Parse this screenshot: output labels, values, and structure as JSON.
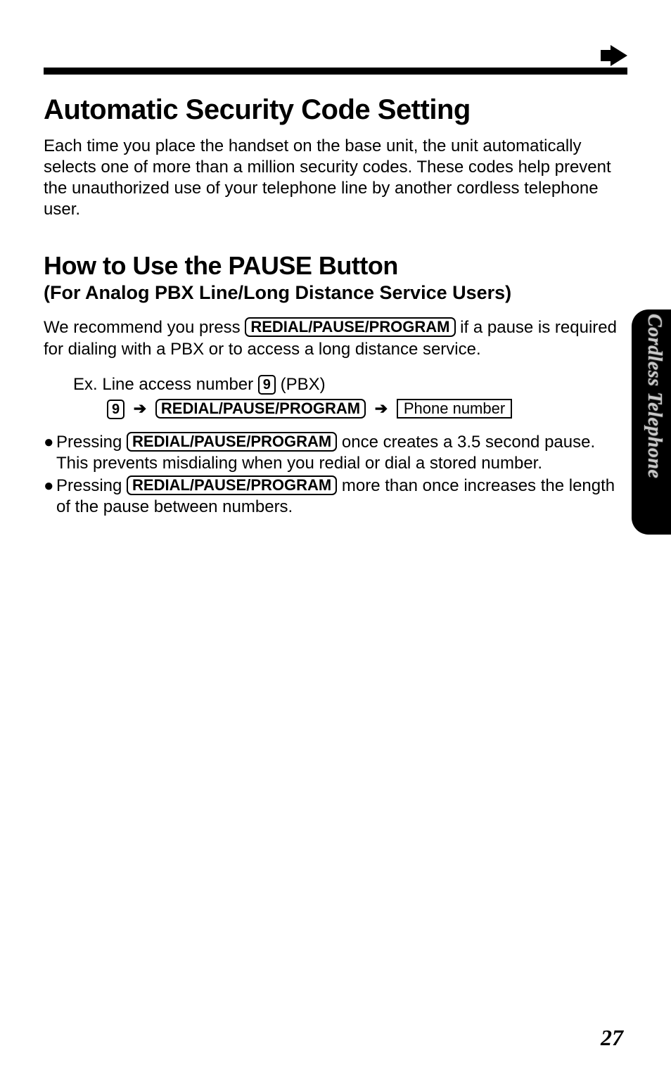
{
  "page_number": "27",
  "side_tab": "Cordless Telephone",
  "section1": {
    "title": "Automatic Security Code Setting",
    "body": "Each time you place the handset on the base unit, the unit automatically selects one of more than a million security codes. These codes help prevent the unauthorized use of your telephone line by another cordless telephone user."
  },
  "section2": {
    "title": "How to Use the PAUSE Button",
    "subtitle": "(For Analog PBX Line/Long Distance Service Users)",
    "para_pre": "We recommend you press ",
    "key_redial": "REDIAL/PAUSE/PROGRAM",
    "para_post": " if a pause is required for dialing with a PBX or to access a long distance service.",
    "example": {
      "line1_pre": "Ex. Line access number ",
      "key_9": "9",
      "line1_post": " (PBX)",
      "box_phone": "Phone number"
    },
    "bullets": {
      "b1_pre": "Pressing ",
      "b1_post": " once creates a 3.5 second pause. This prevents misdialing when you redial or dial a stored number.",
      "b2_pre": "Pressing ",
      "b2_post": " more than once increases the length of the pause between numbers."
    }
  }
}
